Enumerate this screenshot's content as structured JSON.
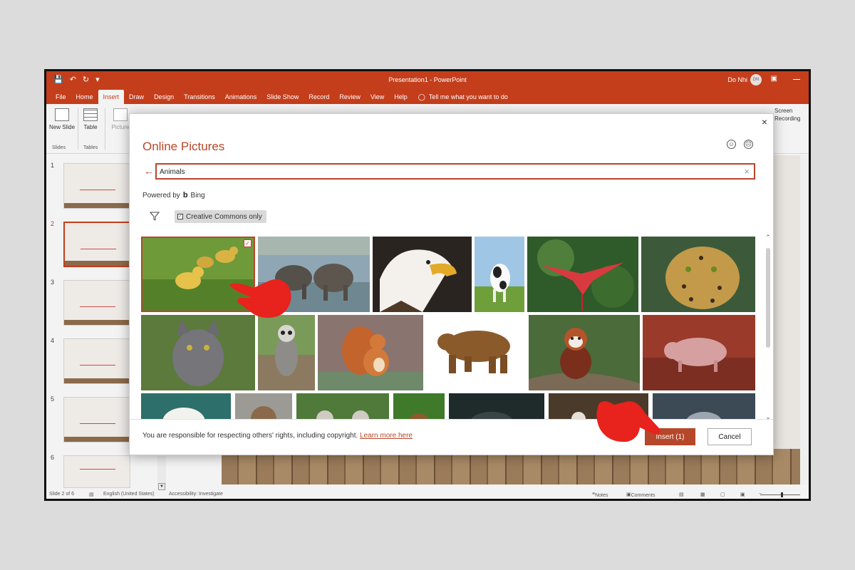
{
  "window": {
    "title": "Presentation1 - PowerPoint",
    "user_name": "Do Nhi",
    "user_initials": "DN",
    "accent": "#c43e1c"
  },
  "tabs": [
    "File",
    "Home",
    "Insert",
    "Draw",
    "Design",
    "Transitions",
    "Animations",
    "Slide Show",
    "Record",
    "Review",
    "View",
    "Help"
  ],
  "active_tab": "Insert",
  "tell_me": "Tell me what you want to do",
  "ribbon": {
    "new_slide": "New Slide",
    "table": "Table",
    "pictures": "Picture",
    "group_slides": "Slides",
    "group_tables": "Tables",
    "screen_recording": "Screen Recording"
  },
  "slides": [
    "1",
    "2",
    "3",
    "4",
    "5",
    "6"
  ],
  "selected_slide": 2,
  "statusbar": {
    "slide_info": "Slide 2 of 6",
    "language": "English (United States)",
    "accessibility": "Accessibility: Investigate",
    "notes": "Notes",
    "comments": "Comments"
  },
  "dialog": {
    "title": "Online Pictures",
    "search_value": "Animals",
    "powered_by": "Powered by",
    "bing": "Bing",
    "creative_commons": "Creative Commons only",
    "copyright_text": "You are responsible for respecting others' rights, including copyright.",
    "learn_more": "Learn more here",
    "insert_label": "Insert (1)",
    "cancel_label": "Cancel",
    "accent": "#b7472a"
  },
  "images": [
    {
      "subject": "ducklings",
      "selected": true
    },
    {
      "subject": "elephants"
    },
    {
      "subject": "bald-eagle"
    },
    {
      "subject": "cow"
    },
    {
      "subject": "scarlet-ibis"
    },
    {
      "subject": "leopard"
    },
    {
      "subject": "cat"
    },
    {
      "subject": "lemur"
    },
    {
      "subject": "squirrel"
    },
    {
      "subject": "brown-bear"
    },
    {
      "subject": "red-panda"
    },
    {
      "subject": "piglet"
    },
    {
      "subject": "polar-bear"
    },
    {
      "subject": "llama"
    },
    {
      "subject": "lemurs"
    },
    {
      "subject": "deer"
    },
    {
      "subject": "dark-animal"
    },
    {
      "subject": "red-panda-2"
    },
    {
      "subject": "seal"
    }
  ]
}
